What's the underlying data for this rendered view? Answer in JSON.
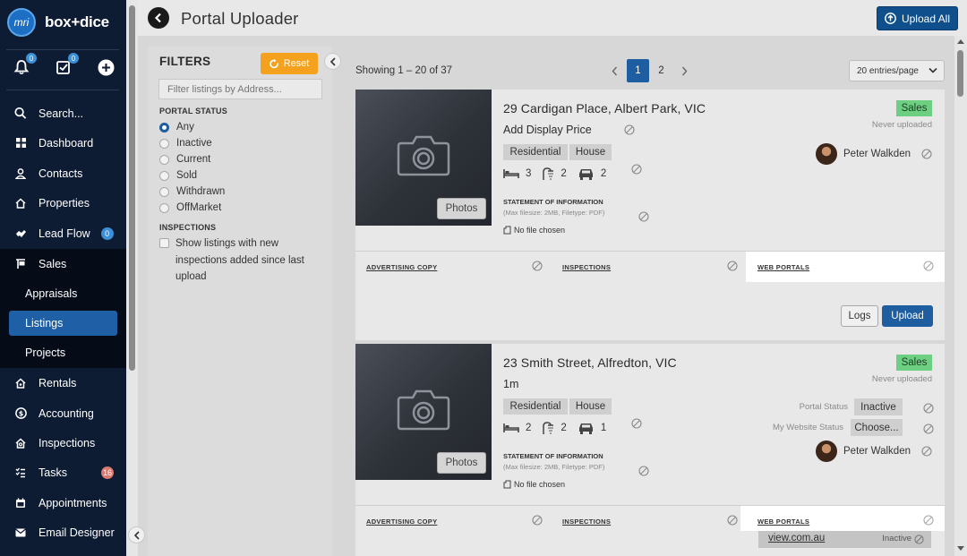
{
  "brand": {
    "logo_mark": "mri",
    "name": "box+dice"
  },
  "toolbar": {
    "notifications_count": "0",
    "tasks_count": "0"
  },
  "nav": {
    "search": "Search...",
    "dashboard": "Dashboard",
    "contacts": "Contacts",
    "properties": "Properties",
    "lead_flow": "Lead Flow",
    "lead_flow_count": "0",
    "sales": "Sales",
    "appraisals": "Appraisals",
    "listings": "Listings",
    "projects": "Projects",
    "rentals": "Rentals",
    "accounting": "Accounting",
    "inspections": "Inspections",
    "tasks": "Tasks",
    "tasks_count": "16",
    "appointments": "Appointments",
    "email_designer": "Email Designer"
  },
  "header": {
    "title": "Portal Uploader",
    "upload_all": "Upload All"
  },
  "filters": {
    "title": "FILTERS",
    "reset": "Reset",
    "address_placeholder": "Filter listings by Address...",
    "portal_status_heading": "PORTAL STATUS",
    "portal_status_options": [
      "Any",
      "Inactive",
      "Current",
      "Sold",
      "Withdrawn",
      "OffMarket"
    ],
    "selected": "Any",
    "inspections_heading": "INSPECTIONS",
    "inspections_checkbox": "Show listings with new inspections added since last upload"
  },
  "results": {
    "showing": "Showing 1 – 20 of 37",
    "pages": [
      "1",
      "2"
    ],
    "current_page": "1",
    "entries_per_page": "20 entries/page"
  },
  "listings": [
    {
      "address": "29 Cardigan Place, Albert Park, VIC",
      "price": "Add Display Price",
      "tags": [
        "Residential",
        "House"
      ],
      "beds": "3",
      "baths": "2",
      "cars": "2",
      "photos_label": "Photos",
      "soi_title": "STATEMENT OF INFORMATION",
      "soi_hint": "(Max filesize: 2MB, Filetype: PDF)",
      "no_file": "No file chosen",
      "status_badge": "Sales",
      "upload_state": "Never uploaded",
      "agent": "Peter Walkden",
      "tabs": [
        "ADVERTISING COPY",
        "INSPECTIONS",
        "WEB PORTALS"
      ],
      "logs_label": "Logs",
      "upload_label": "Upload"
    },
    {
      "address": "23 Smith Street, Alfredton, VIC",
      "price": "1m",
      "tags": [
        "Residential",
        "House"
      ],
      "beds": "2",
      "baths": "2",
      "cars": "1",
      "photos_label": "Photos",
      "soi_title": "STATEMENT OF INFORMATION",
      "soi_hint": "(Max filesize: 2MB, Filetype: PDF)",
      "no_file": "No file chosen",
      "status_badge": "Sales",
      "upload_state": "Never uploaded",
      "portal_status_label": "Portal Status",
      "portal_status_value": "Inactive",
      "website_status_label": "My Website Status",
      "website_status_value": "Choose...",
      "agent": "Peter Walkden",
      "tabs": [
        "ADVERTISING COPY",
        "INSPECTIONS",
        "WEB PORTALS"
      ],
      "portal_name": "view.com.au",
      "portal_state": "Inactive"
    }
  ],
  "colors": {
    "sidebar": "#0d1b33",
    "accent": "#1e5d9f",
    "reset": "#f4a21d",
    "sales_badge": "#6ccf82"
  }
}
